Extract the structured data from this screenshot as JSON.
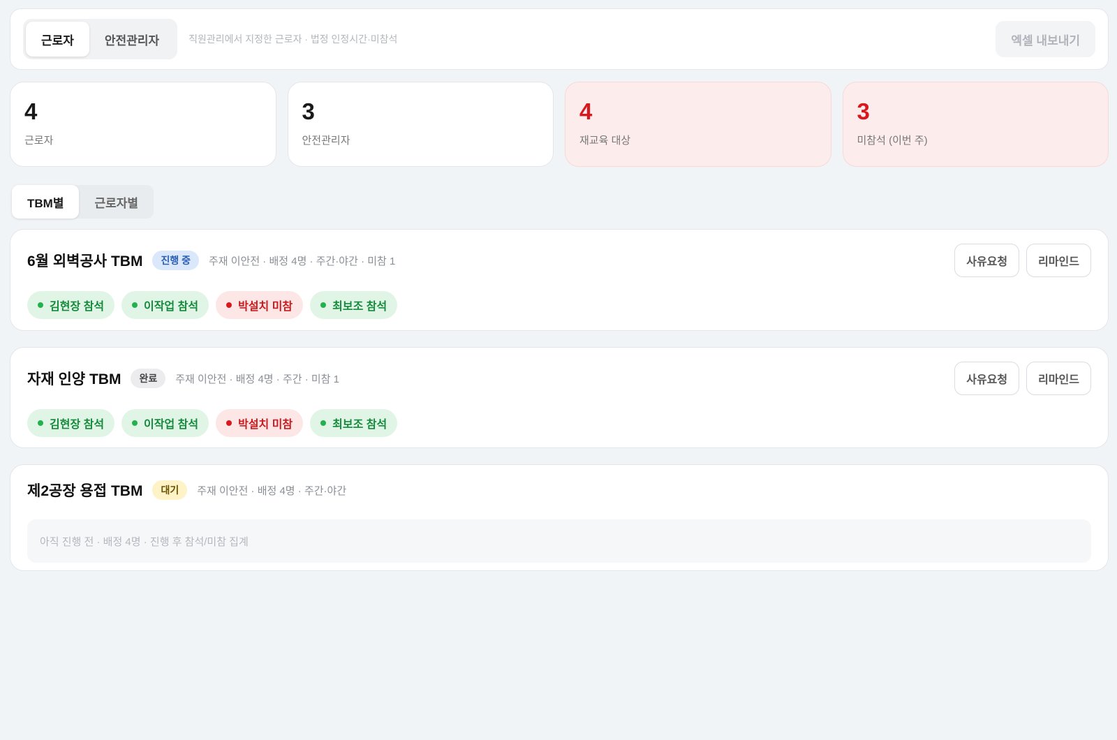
{
  "topbar": {
    "roles": [
      "근로자",
      "안전관리자"
    ],
    "active_role": 0,
    "description": "직원관리에서 지정한 근로자 · 법정 인정시간·미참석",
    "export_label": "엑셀 내보내기"
  },
  "stats": [
    {
      "value": "4",
      "label": "근로자",
      "alert": false
    },
    {
      "value": "3",
      "label": "안전관리자",
      "alert": false
    },
    {
      "value": "4",
      "label": "재교육 대상",
      "alert": true
    },
    {
      "value": "3",
      "label": "미참석 (이번 주)",
      "alert": true
    }
  ],
  "view_tabs": [
    "TBM별",
    "근로자별"
  ],
  "active_view": 0,
  "colors": {
    "present": "#22b14c",
    "absent": "#d7191f",
    "progress_badge": "#dbe8fb",
    "wait_badge": "#fdf3c6"
  },
  "tbms": [
    {
      "title": "6월 외벽공사 TBM",
      "status": "진행 중",
      "meta": "주재 이안전 · 배정 4명 · 주간·야간 · 미참 1",
      "actions": [
        "사유요청",
        "리마인드"
      ],
      "attendees": [
        {
          "label": "김현장 참석",
          "present": true
        },
        {
          "label": "이작업 참석",
          "present": true
        },
        {
          "label": "박설치 미참",
          "present": false
        },
        {
          "label": "최보조 참석",
          "present": true
        }
      ]
    },
    {
      "title": "자재 인양 TBM",
      "status": "완료",
      "meta": "주재 이안전 · 배정 4명 · 주간 · 미참 1",
      "actions": [
        "사유요청",
        "리마인드"
      ],
      "attendees": [
        {
          "label": "김현장 참석",
          "present": true
        },
        {
          "label": "이작업 참석",
          "present": true
        },
        {
          "label": "박설치 미참",
          "present": false
        },
        {
          "label": "최보조 참석",
          "present": true
        }
      ]
    },
    {
      "title": "제2공장 용접 TBM",
      "status": "대기",
      "meta": "주재 이안전 · 배정 4명 · 주간·야간",
      "pending_note": "아직 진행 전 · 배정 4명 · 진행 후 참석/미참 집계"
    }
  ]
}
